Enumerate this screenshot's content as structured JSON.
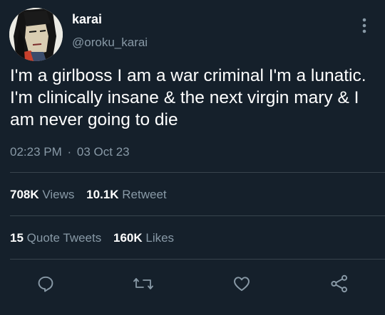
{
  "tweet": {
    "display_name": "karai",
    "handle": "@oroku_karai",
    "text": "I'm a girlboss I am a war criminal I'm a lunatic. I'm clinically insane & the next virgin mary & I am never going to die",
    "time": "02:23 PM",
    "separator": "·",
    "date": "03 Oct 23"
  },
  "stats": {
    "views": {
      "count": "708K",
      "label": "Views"
    },
    "retweets": {
      "count": "10.1K",
      "label": "Retweet"
    },
    "quote_tweets": {
      "count": "15",
      "label": "Quote Tweets"
    },
    "likes": {
      "count": "160K",
      "label": "Likes"
    }
  },
  "icons": {
    "avatar": "avatar-illustration",
    "more": "more-vertical-icon",
    "reply": "reply-icon",
    "retweet": "retweet-icon",
    "like": "heart-icon",
    "share": "share-icon"
  },
  "colors": {
    "background": "#15202b",
    "text": "#ffffff",
    "muted": "#8899a6",
    "divider": "#38444d"
  }
}
